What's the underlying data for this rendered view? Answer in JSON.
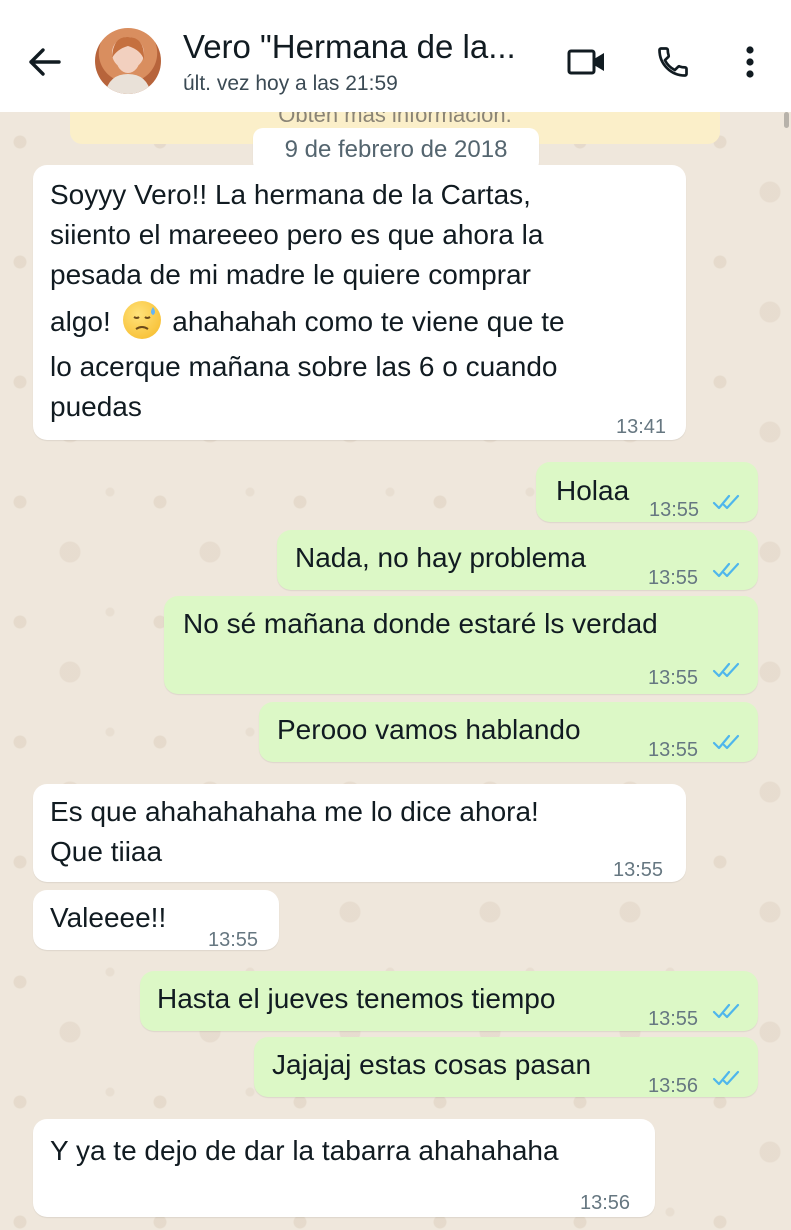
{
  "header": {
    "contact_name": "Vero \"Hermana de la...",
    "status": "últ. vez hoy a las 21:59",
    "icons": [
      "back-arrow-icon",
      "video-call-icon",
      "phone-icon",
      "more-vert-icon"
    ]
  },
  "chat": {
    "encryption_notice_partial": "Obtén más información.",
    "date_chip": "9 de febrero de 2018",
    "messages": [
      {
        "dir": "in",
        "lines": [
          "Soyyy Vero!! La hermana de la Cartas,",
          "siiento el mareeeo pero es que ahora la",
          "pesada de mi madre le quiere comprar"
        ],
        "line4_before": "algo!",
        "line4_after": "ahahahah como te viene que te",
        "lines_after": [
          "lo acerque mañana sobre las 6 o cuando",
          "puedas"
        ],
        "time": "13:41"
      },
      {
        "dir": "out",
        "text": "Holaa",
        "time": "13:55"
      },
      {
        "dir": "out",
        "text": "Nada, no hay problema",
        "time": "13:55"
      },
      {
        "dir": "out",
        "text": "No sé mañana donde estaré ls verdad",
        "time": "13:55"
      },
      {
        "dir": "out",
        "text": "Perooo vamos hablando",
        "time": "13:55"
      },
      {
        "dir": "in",
        "lines": [
          "Es que ahahahahaha me lo dice ahora!",
          "Que tiiaa"
        ],
        "time": "13:55"
      },
      {
        "dir": "in",
        "text": "Valeeee!!",
        "time": "13:55"
      },
      {
        "dir": "out",
        "text": "Hasta el jueves tenemos tiempo",
        "time": "13:55"
      },
      {
        "dir": "out",
        "text": "Jajajaj estas cosas pasan",
        "time": "13:56"
      },
      {
        "dir": "in",
        "text": "Y ya te dejo de dar la tabarra ahahahaha",
        "time": "13:56"
      }
    ]
  },
  "colors": {
    "outgoing_bubble": "#dcf8c6",
    "incoming_bubble": "#ffffff",
    "read_ticks": "#4fb6ec",
    "chat_bg": "#efe7dc"
  }
}
